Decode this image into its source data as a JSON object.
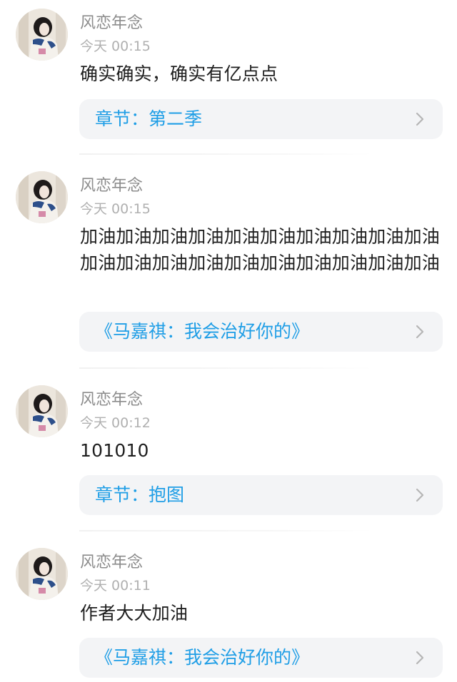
{
  "comments": [
    {
      "username": "风恋年念",
      "time": "今天 00:15",
      "text": "确实确实，确实有亿点点",
      "reference": "章节：第二季",
      "avatar_icon": "user-avatar"
    },
    {
      "username": "风恋年念",
      "time": "今天 00:15",
      "text": "加油加油加油加油加油加油加油加油加油加油加油加油加油加油加油加油加油加油加油加油",
      "reference": "《马嘉祺：我会治好你的》",
      "avatar_icon": "user-avatar"
    },
    {
      "username": "风恋年念",
      "time": "今天 00:12",
      "text": "101010",
      "reference": "章节：抱图",
      "avatar_icon": "user-avatar"
    },
    {
      "username": "风恋年念",
      "time": "今天 00:11",
      "text": "作者大大加油",
      "reference": "《马嘉祺：我会治好你的》",
      "avatar_icon": "user-avatar"
    }
  ],
  "colors": {
    "accent": "#1f9ee6",
    "username": "#8c8c8c",
    "time": "#b0b0b0",
    "body": "#1f1f1f",
    "card_bg": "#f3f4f6"
  },
  "chevron_icon": "chevron-right-icon"
}
